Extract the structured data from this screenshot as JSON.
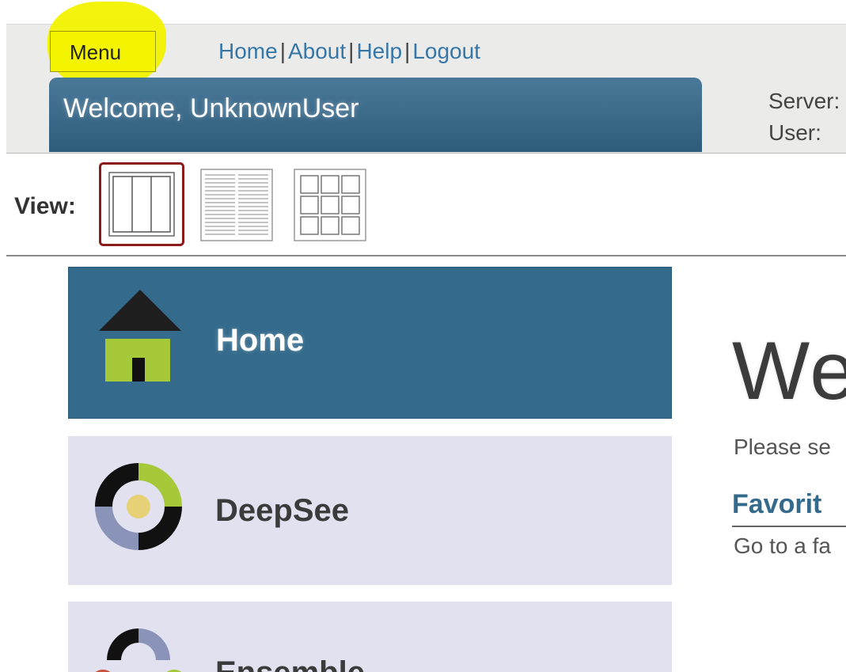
{
  "header": {
    "menu_label": "Menu",
    "links": [
      "Home",
      "About",
      "Help",
      "Logout"
    ],
    "welcome": "Welcome, UnknownUser",
    "server_label": "Server:",
    "user_label": "User:"
  },
  "view": {
    "label": "View:",
    "options": [
      "columns-view-icon",
      "list-view-icon",
      "grid-view-icon"
    ],
    "selected": "columns-view-icon"
  },
  "nav": {
    "items": [
      {
        "label": "Home",
        "icon": "home-icon",
        "selected": true
      },
      {
        "label": "DeepSee",
        "icon": "deepsee-icon",
        "selected": false
      },
      {
        "label": "Ensemble",
        "icon": "ensemble-icon",
        "selected": false
      }
    ]
  },
  "main": {
    "title": "We",
    "subtitle": "Please se",
    "favorites_title": "Favorit",
    "favorites_text": "Go to a fa"
  },
  "colors": {
    "accent_blue": "#346a8b",
    "tile_bg": "#e2e1f0",
    "highlight_yellow": "#f2f200",
    "selected_border": "#8b1a1a",
    "icon_green": "#a6c93a"
  }
}
